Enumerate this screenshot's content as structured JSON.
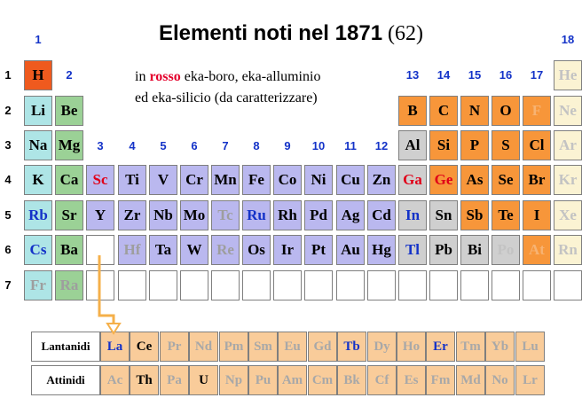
{
  "title": {
    "main": "Elementi noti nel 1871",
    "count": "(62)"
  },
  "note": {
    "line1_prefix": "in ",
    "line1_highlight": "rosso",
    "line1_suffix": " eka-boro, eka-alluminio",
    "line2": "ed eka-silicio (da caratterizzare)"
  },
  "colors": {
    "alkali": "#aee5e6",
    "alkaline_earth": "#9bd196",
    "transition": "#bab8ef",
    "post_transition": "#cfcfcf",
    "nonmetal": "#f7963a",
    "hydrogen": "#ef5a1e",
    "noble_gas": "#fbf3d3",
    "lanthanide_actinide": "#f9cc9a",
    "known_text": "#000000",
    "unknown_text": "#9e9e9e",
    "predicted_text": "#e00018",
    "highlight_text": "#1432c8",
    "arrow": "#f5b04a"
  },
  "group_labels": [
    "1",
    "2",
    "3",
    "4",
    "5",
    "6",
    "7",
    "8",
    "9",
    "10",
    "11",
    "12",
    "13",
    "14",
    "15",
    "16",
    "17",
    "18"
  ],
  "period_labels": [
    "1",
    "2",
    "3",
    "4",
    "5",
    "6",
    "7"
  ],
  "main_table": [
    [
      "H",
      "",
      "",
      "",
      "",
      "",
      "",
      "",
      "",
      "",
      "",
      "",
      "",
      "",
      "",
      "",
      "",
      "He"
    ],
    [
      "Li",
      "Be",
      "",
      "",
      "",
      "",
      "",
      "",
      "",
      "",
      "",
      "",
      "B",
      "C",
      "N",
      "O",
      "F",
      "Ne"
    ],
    [
      "Na",
      "Mg",
      "",
      "",
      "",
      "",
      "",
      "",
      "",
      "",
      "",
      "",
      "Al",
      "Si",
      "P",
      "S",
      "Cl",
      "Ar"
    ],
    [
      "K",
      "Ca",
      "Sc",
      "Ti",
      "V",
      "Cr",
      "Mn",
      "Fe",
      "Co",
      "Ni",
      "Cu",
      "Zn",
      "Ga",
      "Ge",
      "As",
      "Se",
      "Br",
      "Kr"
    ],
    [
      "Rb",
      "Sr",
      "Y",
      "Zr",
      "Nb",
      "Mo",
      "Tc",
      "Ru",
      "Rh",
      "Pd",
      "Ag",
      "Cd",
      "In",
      "Sn",
      "Sb",
      "Te",
      "I",
      "Xe"
    ],
    [
      "Cs",
      "Ba",
      "",
      "Hf",
      "Ta",
      "W",
      "Re",
      "Os",
      "Ir",
      "Pt",
      "Au",
      "Hg",
      "Tl",
      "Pb",
      "Bi",
      "Po",
      "At",
      "Rn"
    ],
    [
      "Fr",
      "Ra",
      "",
      "",
      "",
      "",
      "",
      "",
      "",
      "",
      "",
      "",
      "",
      "",
      "",
      "",
      "",
      ""
    ]
  ],
  "series": [
    {
      "label": "Lantanidi",
      "elements": [
        "La",
        "Ce",
        "Pr",
        "Nd",
        "Pm",
        "Sm",
        "Eu",
        "Gd",
        "Tb",
        "Dy",
        "Ho",
        "Er",
        "Tm",
        "Yb",
        "Lu"
      ]
    },
    {
      "label": "Attinidi",
      "elements": [
        "Ac",
        "Th",
        "Pa",
        "U",
        "Np",
        "Pu",
        "Am",
        "Cm",
        "Bk",
        "Cf",
        "Es",
        "Fm",
        "Md",
        "No",
        "Lr"
      ]
    }
  ]
}
